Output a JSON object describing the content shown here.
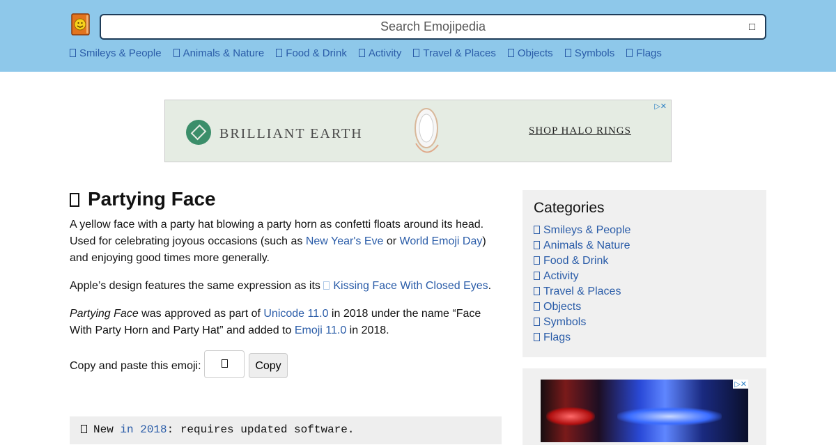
{
  "header": {
    "search_placeholder": "Search Emojipedia",
    "search_icon": "magnifier-icon",
    "nav": [
      {
        "label": "Smileys & People"
      },
      {
        "label": "Animals & Nature"
      },
      {
        "label": "Food & Drink"
      },
      {
        "label": "Activity"
      },
      {
        "label": "Travel & Places"
      },
      {
        "label": "Objects"
      },
      {
        "label": "Symbols"
      },
      {
        "label": "Flags"
      }
    ]
  },
  "ad": {
    "brand": "BRILLIANT EARTH",
    "cta": "SHOP HALO RINGS"
  },
  "article": {
    "title": "Partying Face",
    "p1_a": "A yellow face with a party hat blowing a party horn as confetti floats around its head. Used for celebrating joyous occasions (such as ",
    "p1_link1": "New Year's Eve",
    "p1_b": " or ",
    "p1_link2": "World Emoji Day",
    "p1_c": ") and enjoying good times more generally.",
    "p2_a": "Apple’s design features the same expression as its ",
    "p2_link": "Kissing Face With Closed Eyes",
    "p2_b": ".",
    "p3_em": "Partying Face",
    "p3_a": " was approved as part of ",
    "p3_link1": "Unicode 11.0",
    "p3_b": " in 2018 under the name “Face With Party Horn and Party Hat” and added to ",
    "p3_link2": "Emoji 11.0",
    "p3_c": " in 2018.",
    "copy_label": "Copy and paste this emoji:",
    "copy_button": "Copy",
    "notice_a": "New ",
    "notice_link": "in 2018",
    "notice_b": ": requires updated software."
  },
  "sidebar": {
    "title": "Categories",
    "items": [
      {
        "label": "Smileys & People"
      },
      {
        "label": "Animals & Nature"
      },
      {
        "label": "Food & Drink"
      },
      {
        "label": "Activity"
      },
      {
        "label": "Travel & Places"
      },
      {
        "label": "Objects"
      },
      {
        "label": "Symbols"
      },
      {
        "label": "Flags"
      }
    ]
  },
  "colors": {
    "header_bg": "#8ec8ea",
    "link": "#2a5ca8",
    "sidebar_bg": "#f0f0f0"
  }
}
